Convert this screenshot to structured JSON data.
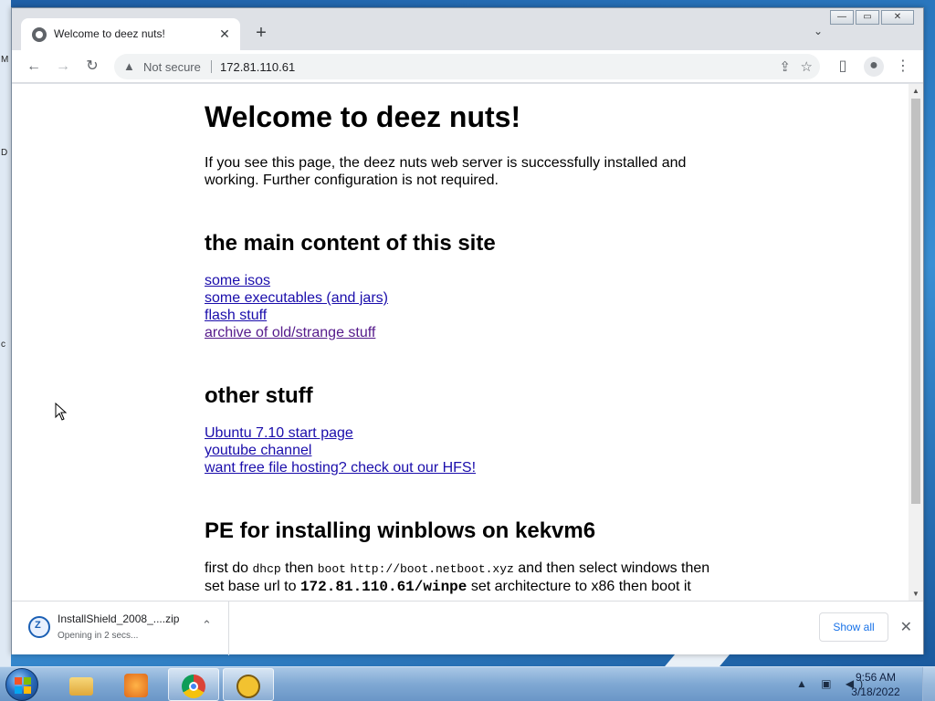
{
  "browser": {
    "tab": {
      "title": "Welcome to deez nuts!",
      "close": "✕"
    },
    "newtab": "+",
    "tab_menu": "⌄",
    "window_buttons": {
      "minimize": "—",
      "maximize": "▭",
      "close": "✕"
    },
    "nav": {
      "back": "←",
      "forward": "→",
      "reload": "↻"
    },
    "omnibox": {
      "security": "Not secure",
      "url": "172.81.110.61"
    },
    "actions": {
      "share": "⇪",
      "bookmark": "☆",
      "sidepanel": "▯",
      "profile": "●",
      "menu": "⋮"
    }
  },
  "page": {
    "h1": "Welcome to deez nuts!",
    "intro": "If you see this page, the deez nuts web server is successfully installed and working. Further configuration is not required.",
    "section_main": {
      "title": "the main content of this site",
      "links": [
        "some isos",
        "some executables (and jars)",
        "flash stuff",
        "archive of old/strange stuff"
      ]
    },
    "section_other": {
      "title": "other stuff",
      "links": [
        "Ubuntu 7.10 start page",
        "youtube channel",
        "want free file hosting? check out our HFS!"
      ]
    },
    "section_pe": {
      "title": "PE for installing winblows on kekvm6",
      "t1": "first do ",
      "c1": "dhcp",
      "t2": " then ",
      "c2": "boot",
      "c3": "http://boot.netboot.xyz",
      "t3": " and then select windows then set base url to ",
      "b1": "172.81.110.61/winpe",
      "t4": " set architecture to x86 then boot it"
    }
  },
  "download": {
    "filename": "InstallShield_2008_....zip",
    "status": "Opening in 2 secs...",
    "chevron": "⌃",
    "show_all": "Show all",
    "close": "✕"
  },
  "taskbar": {
    "time": "9:56 AM",
    "date": "3/18/2022",
    "tray_icons": "▲ ▣ ◀)"
  },
  "desktop": {
    "letters": [
      "M",
      "D",
      "c"
    ]
  }
}
